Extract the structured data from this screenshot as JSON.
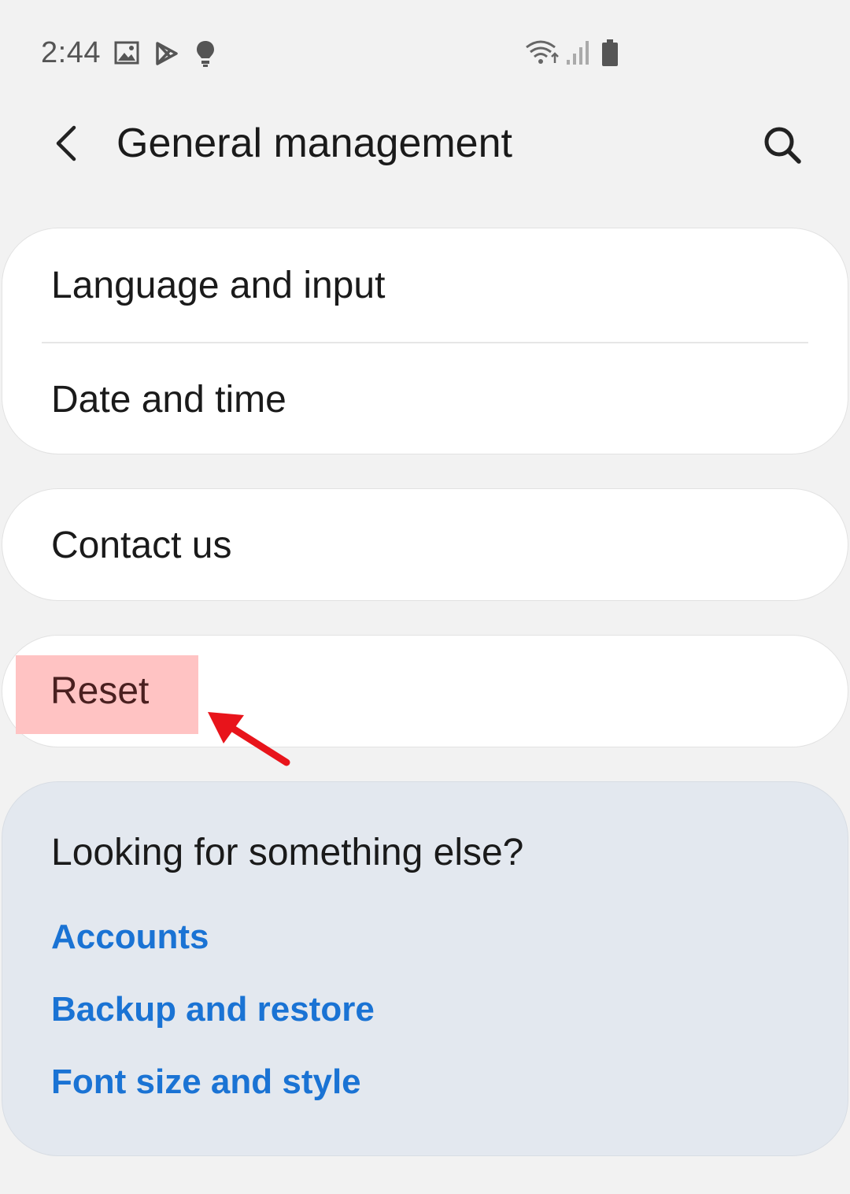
{
  "status_bar": {
    "time": "2:44",
    "icons": [
      "gallery-icon",
      "play-store-icon",
      "bulb-icon",
      "wifi-icon",
      "signal-icon",
      "battery-icon"
    ]
  },
  "header": {
    "title": "General management",
    "back_icon": "chevron-left-icon",
    "search_icon": "search-icon"
  },
  "groups": [
    {
      "items": [
        {
          "label": "Language and input"
        },
        {
          "label": "Date and time"
        }
      ]
    },
    {
      "items": [
        {
          "label": "Contact us"
        }
      ]
    },
    {
      "items": [
        {
          "label": "Reset"
        }
      ]
    }
  ],
  "suggestions": {
    "title": "Looking for something else?",
    "links": [
      {
        "label": "Accounts"
      },
      {
        "label": "Backup and restore"
      },
      {
        "label": "Font size and style"
      }
    ]
  },
  "annotation": {
    "highlight_color": "#ffc3c3",
    "arrow_color": "#e8141b"
  },
  "colors": {
    "background": "#f2f2f2",
    "card": "#ffffff",
    "suggest_card": "#e3e8ef",
    "link": "#1a73d4"
  }
}
